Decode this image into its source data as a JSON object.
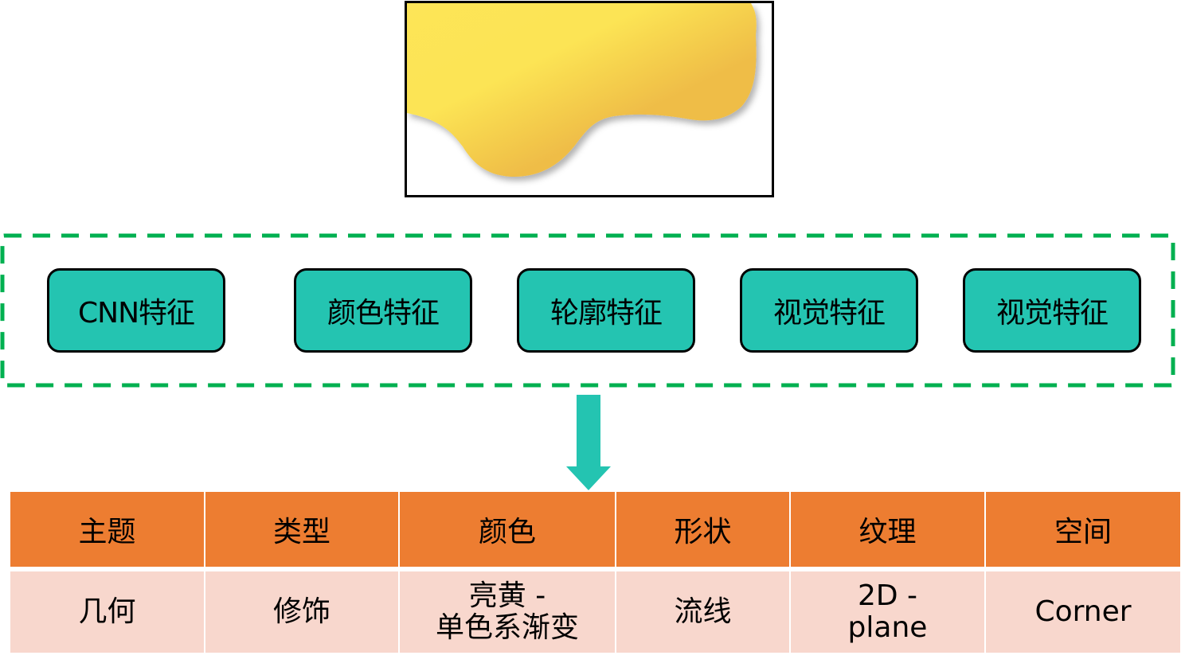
{
  "image_preview": {
    "description": "yellow gradient blob decoration",
    "colors": {
      "light": "#fde558",
      "dark": "#efbd47",
      "border": "#000000"
    }
  },
  "feature_frame": {
    "border_color": "#00b050",
    "features": [
      {
        "label": "CNN特征"
      },
      {
        "label": "颜色特征"
      },
      {
        "label": "轮廓特征"
      },
      {
        "label": "视觉特征"
      },
      {
        "label": "视觉特征"
      }
    ],
    "box_color": "#24c4b1"
  },
  "arrow": {
    "direction": "down",
    "color": "#24c4b1"
  },
  "attribute_table": {
    "header_color": "#ed7d31",
    "row_color": "#f8d7cd",
    "headers": [
      "主题",
      "类型",
      "颜色",
      "形状",
      "纹理",
      "空间"
    ],
    "values": [
      {
        "line1": "几何",
        "line2": ""
      },
      {
        "line1": "修饰",
        "line2": ""
      },
      {
        "line1": "亮黄 -",
        "line2": "单色系渐变"
      },
      {
        "line1": "流线",
        "line2": ""
      },
      {
        "line1": "2D -",
        "line2": "plane"
      },
      {
        "line1": "Corner",
        "line2": ""
      }
    ]
  }
}
